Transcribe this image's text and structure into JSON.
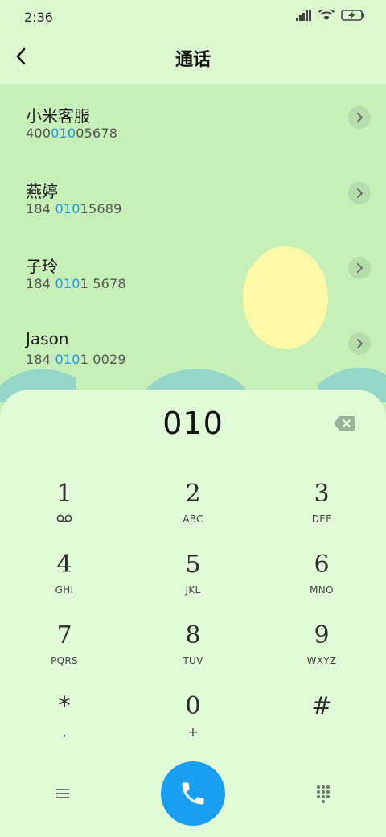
{
  "status": {
    "time": "2:36"
  },
  "header": {
    "title": "通话"
  },
  "contacts": [
    {
      "name": "小米客服",
      "number_pre": "400",
      "number_hl": "010",
      "number_post": "05678"
    },
    {
      "name": "燕婷",
      "number_pre": "184 ",
      "number_hl": "010",
      "number_post": "15689"
    },
    {
      "name": "子玲",
      "number_pre": "184 ",
      "number_hl": "010",
      "number_post": "1 5678"
    },
    {
      "name": "Jason",
      "number_pre": "184 ",
      "number_hl": "010",
      "number_post": "1 0029"
    }
  ],
  "dialer": {
    "input": "010",
    "keys": [
      {
        "digit": "1",
        "sub": ""
      },
      {
        "digit": "2",
        "sub": "ABC"
      },
      {
        "digit": "3",
        "sub": "DEF"
      },
      {
        "digit": "4",
        "sub": "GHI"
      },
      {
        "digit": "5",
        "sub": "JKL"
      },
      {
        "digit": "6",
        "sub": "MNO"
      },
      {
        "digit": "7",
        "sub": "PQRS"
      },
      {
        "digit": "8",
        "sub": "TUV"
      },
      {
        "digit": "9",
        "sub": "WXYZ"
      },
      {
        "digit": "*",
        "sub": ","
      },
      {
        "digit": "0",
        "sub": "+"
      },
      {
        "digit": "#",
        "sub": ""
      }
    ]
  },
  "icons": {
    "back": "back-arrow-icon",
    "chevron": "chevron-right-icon",
    "backspace": "backspace-icon",
    "voicemail": "voicemail-icon",
    "menu": "menu-icon",
    "call": "phone-icon",
    "keypad": "dialpad-icon",
    "signal": "signal-icon",
    "wifi": "wifi-icon",
    "battery": "battery-charging-icon"
  },
  "colors": {
    "accent": "#1a9ef2",
    "highlight": "#1c9be3",
    "list_bg": "#c7f0b8",
    "dialer_bg": "#e1fbd8"
  }
}
